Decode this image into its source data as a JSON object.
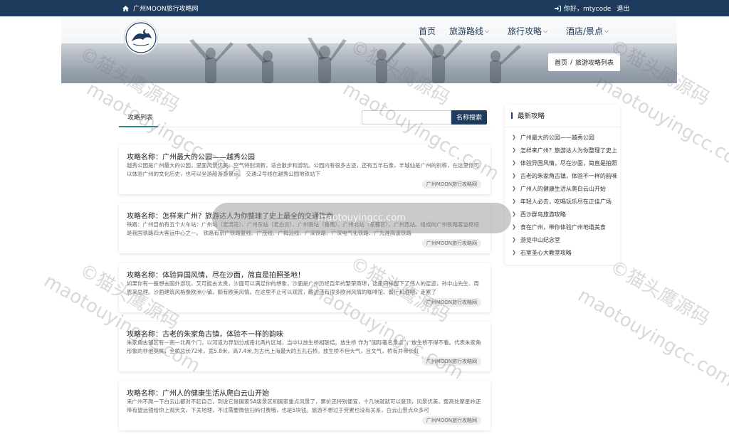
{
  "topbar": {
    "brand": "广州MOON旅行攻略网",
    "greeting": "你好，mtycode",
    "logout": "退出"
  },
  "nav": {
    "items": [
      {
        "label": "首页",
        "has_dropdown": false
      },
      {
        "label": "旅游路线",
        "has_dropdown": true
      },
      {
        "label": "旅行攻略",
        "has_dropdown": true
      },
      {
        "label": "酒店/景点",
        "has_dropdown": true
      }
    ]
  },
  "breadcrumb": {
    "home": "首页",
    "separator": "/",
    "current": "旅游攻略列表"
  },
  "list": {
    "tab_label": "攻略列表",
    "search_button": "名称搜索",
    "cards": [
      {
        "title": "攻略名称：广州最大的公园——越秀公园",
        "excerpt": "越秀公园是广州最大的公园，里面风景优美、空气特别清新，适合散步和游玩。公园内有很多古迹，还有五羊石像，羊城仙是广州的别称，在这里你可以体验广州的文化历史，也可以坐游船游游景点。 交通:2号线在越秀公园地铁站下",
        "tag": "广州MOON旅行攻略网"
      },
      {
        "title": "攻略名称：怎样来广州？旅游达人为你整理了史上最全的交通指南",
        "excerpt": "铁路：广州目前有五个火车站：广州站（老流花）、广州东站（老白云）、广州南站（番禺）、广州北站（花都区）、广州西站。组成的广州铁路客运枢纽是我国铁路四大客运中心之一。 铁路有京广铁路复线、广茂线、广梅汕线、广深铁路、广深电气化铁路、广九准高速铁路",
        "tag": "广州MOON旅行攻略网"
      },
      {
        "title": "攻略名称：体验异国风情，尽在沙面，简直是拍照圣地！",
        "excerpt": "如果你有一股想去国外游玩，又可能去太贵，沙面可以满足你的想象，沙面是广州历经百年的繁荣商埠，这里同样留下了伟人的足迹，孙中山先生、周恩来总理。沙面建筑风格像欧洲小镇，颇有欧美风情。在这里不止可以观赏，路边还有很多欧洲风情的咖啡馆、餐厅和酒吧，走累了",
        "tag": "广州MOON旅行攻略网"
      },
      {
        "title": "攻略名称：古老的朱家角古镇，体验不一样的韵味",
        "excerpt": "朱家角古镇区有一南一北两个门，以河道为界划分成南北两片区域，当中以放生桥相联结。放生桥 作为“国际著名景点”，放生桥不得不看。代表朱家角形象的非他莫属，全桥总长72米，宽5.8米，高7.4米,为古代上海最大的五孔石桥。放生桥不但大气，且文气，桥有并带长虹",
        "tag": "广州MOON旅行攻略网"
      },
      {
        "title": "攻略名称：广州人的健康生活从爬白云山开始",
        "excerpt": "来广州不爬一下白云山都对不起自己，到说它是国家5A级景区和国家重点风景了，票价还特别便宜，十几块就就可以登顶，风景优美，整高处摩星岭还带有望远镜给你上观天文，下关地理，不过需要微信扫码付费哦，也是5块钱。旅游不想过于劳累也没有关系，白云山景点众多可",
        "tag": "广州MOON旅行攻略网"
      }
    ]
  },
  "sidebar": {
    "title": "最新攻略",
    "items": [
      "广州最大的公园——越秀公园",
      "怎样来广州？旅游达人为你整理了史上最全的交通指南",
      "体验异国风情，尽在沙面，简直是拍照圣地！",
      "古老的朱家角古镇，体验不一样的韵味",
      "广州人的健康生活从爬白云山开始",
      "年轻人必去，吃喝玩乐尽在正佳广场",
      "西沙群岛旅游攻略",
      "食在广州，带你体验广州地道美食",
      "游览中山纪念堂",
      "石室圣心大教堂攻略"
    ]
  },
  "watermark": {
    "cn": "©猫头鹰源码",
    "en": "maotouyingcc.com"
  },
  "overlay_text": "maotouyingcc.com",
  "colors": {
    "navy": "#1e3a5c",
    "teal_accent": "#2a8a84"
  }
}
